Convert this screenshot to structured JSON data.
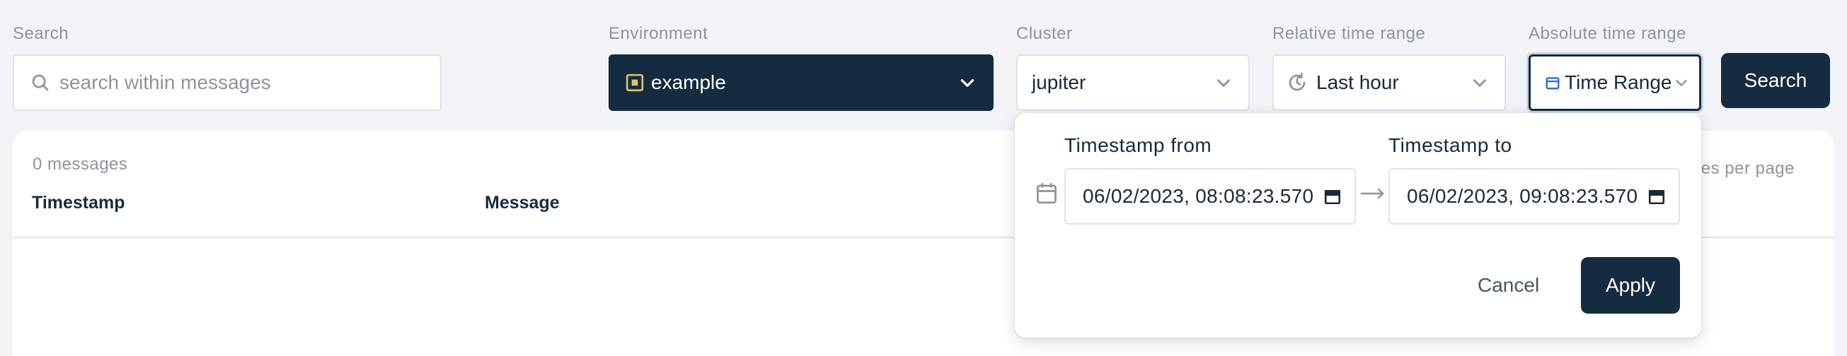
{
  "filters": {
    "search_label": "Search",
    "search_placeholder": "search within messages",
    "environment_label": "Environment",
    "environment_value": "example",
    "cluster_label": "Cluster",
    "cluster_value": "jupiter",
    "relative_label": "Relative time range",
    "relative_value": "Last hour",
    "absolute_label": "Absolute time range",
    "absolute_value": "Time Range",
    "search_button": "Search"
  },
  "results": {
    "count": "0 messages",
    "columns": [
      "Timestamp",
      "Message"
    ],
    "per_page_partial": "ges per page"
  },
  "popover": {
    "from_label": "Timestamp from",
    "from_value": "06/02/2023, 08:08:23.570",
    "to_label": "Timestamp to",
    "to_value": "06/02/2023, 09:08:23.570",
    "cancel": "Cancel",
    "apply": "Apply"
  },
  "colors": {
    "primary": "#142b40",
    "background": "#f1f3f7",
    "muted_text": "#8c949e",
    "environment_icon": "#d9c56a"
  },
  "icons": {
    "search": "search-icon",
    "environment": "environment-square-icon",
    "chevron": "chevron-down-icon",
    "relative": "clock-refresh-icon",
    "absolute": "calendar-icon",
    "arrow": "arrow-right-icon"
  }
}
